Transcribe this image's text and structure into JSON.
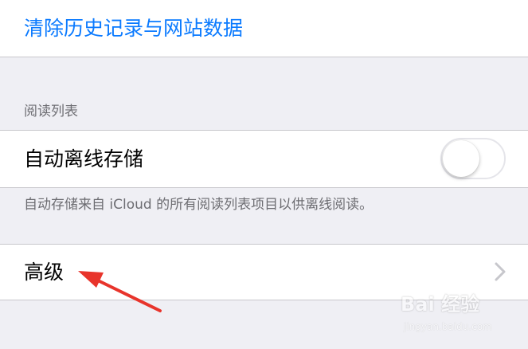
{
  "clear_history": {
    "label": "清除历史记录与网站数据"
  },
  "reading_list": {
    "header": "阅读列表",
    "auto_offline": {
      "label": "自动离线存储",
      "toggle_on": false
    },
    "footer": "自动存储来自 iCloud 的所有阅读列表项目以供离线阅读。"
  },
  "advanced": {
    "label": "高级",
    "chevron_icon": "chevron-right-icon"
  },
  "colors": {
    "link_blue": "#0a7aff",
    "grouped_background": "#efeff4",
    "secondary_text": "#6d6d72",
    "arrow_red": "#e8342b"
  },
  "watermark": {
    "logo": "Bai 经验",
    "url": "jingyan.baidu.com"
  }
}
